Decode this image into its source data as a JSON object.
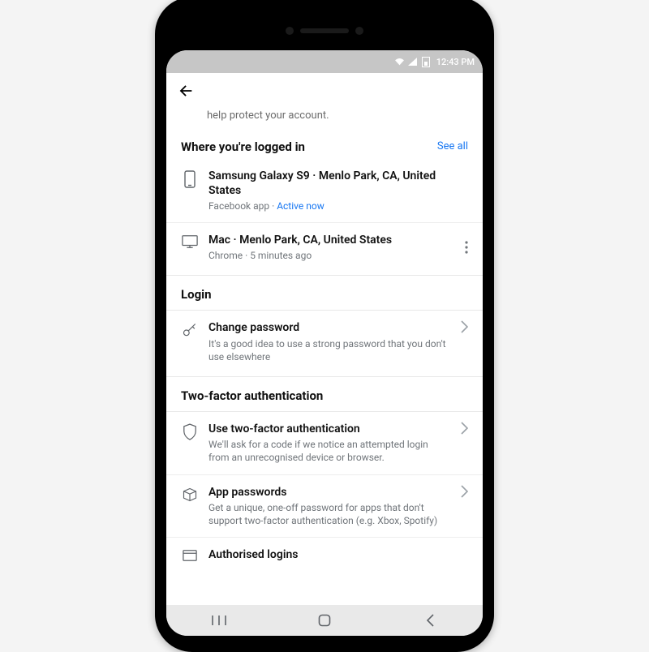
{
  "status": {
    "time": "12:43 PM"
  },
  "helper_text": "help protect your account.",
  "sections": {
    "logged_in": {
      "title": "Where you're logged in",
      "see_all": "See all",
      "items": [
        {
          "title": "Samsung Galaxy S9 · Menlo Park, CA, United States",
          "subtitle_prefix": "Facebook app · ",
          "subtitle_status": "Active now"
        },
        {
          "title": "Mac · Menlo Park, CA, United States",
          "subtitle": "Chrome · 5 minutes ago"
        }
      ]
    },
    "login": {
      "title": "Login",
      "item": {
        "title": "Change password",
        "subtitle": "It's a good idea to use a strong password that you don't use elsewhere"
      }
    },
    "twofactor": {
      "title": "Two-factor authentication",
      "items": [
        {
          "title": "Use two-factor authentication",
          "subtitle": "We'll ask for a code if we notice an attempted login from an unrecognised device or browser."
        },
        {
          "title": "App passwords",
          "subtitle": "Get a unique, one-off password for apps that don't support two-factor authentication (e.g. Xbox, Spotify)"
        },
        {
          "title": "Authorised logins"
        }
      ]
    }
  }
}
